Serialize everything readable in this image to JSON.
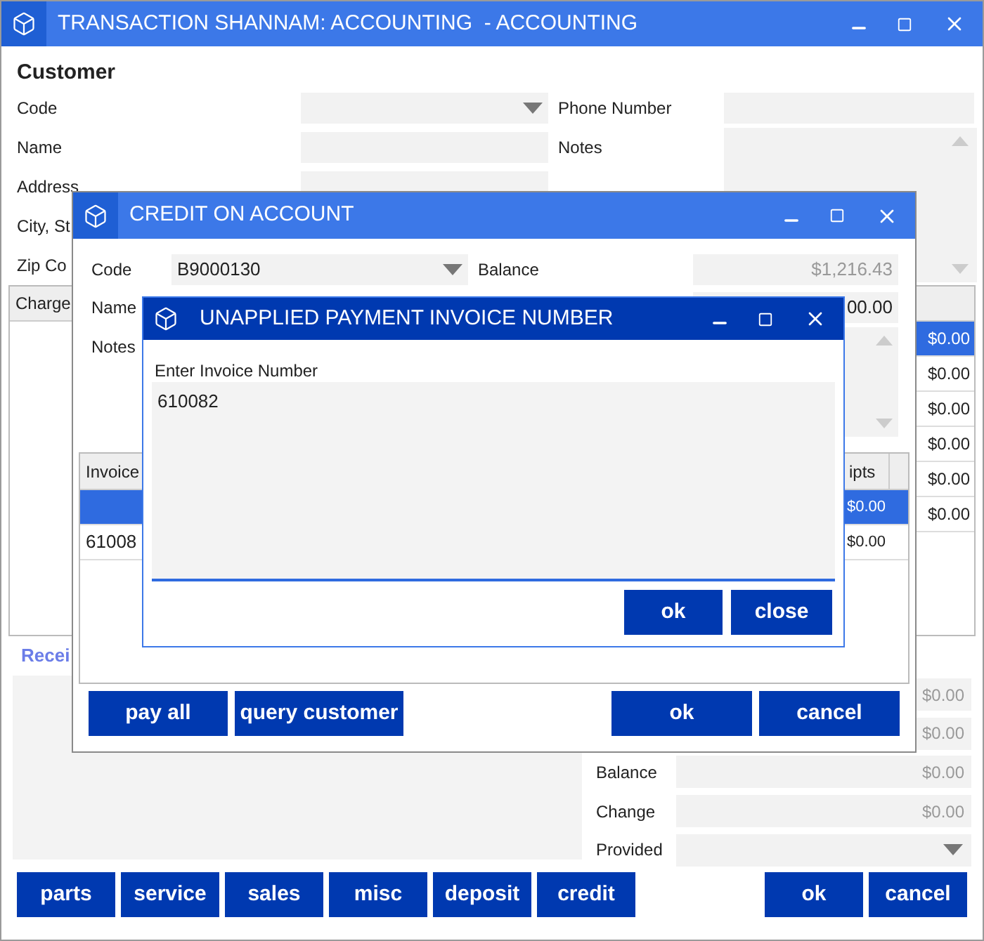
{
  "main": {
    "title": "TRANSACTION SHANNAM: ACCOUNTING  - ACCOUNTING",
    "section": "Customer",
    "left_fields": [
      {
        "label": "Code",
        "kind": "dropdown"
      },
      {
        "label": "Name",
        "kind": "text"
      },
      {
        "label": "Address",
        "kind": "text"
      },
      {
        "label": "City, St",
        "kind": "none"
      },
      {
        "label": "Zip Co",
        "kind": "none"
      }
    ],
    "right_fields": [
      {
        "label": "Phone Number",
        "kind": "text"
      },
      {
        "label": "Notes",
        "kind": "notes"
      }
    ],
    "table": {
      "columns": [
        "Charge"
      ],
      "rows": [
        {
          "value": "$0.00",
          "selected": true
        },
        {
          "value": "$0.00",
          "selected": false
        },
        {
          "value": "$0.00",
          "selected": false
        },
        {
          "value": "$0.00",
          "selected": false
        },
        {
          "value": "$0.00",
          "selected": false
        },
        {
          "value": "$0.00",
          "selected": false
        }
      ]
    },
    "receipts_label": "Recei",
    "totals": [
      {
        "kind": "value",
        "value": "$0.00"
      },
      {
        "kind": "value",
        "value": "$0.00"
      },
      {
        "kind": "value",
        "label": "Balance",
        "value": "$0.00"
      },
      {
        "kind": "value",
        "label": "Change",
        "value": "$0.00"
      },
      {
        "kind": "dropdown",
        "label": "Provided"
      }
    ],
    "buttons_left": [
      "parts",
      "service",
      "sales",
      "misc",
      "deposit",
      "credit"
    ],
    "buttons_right": [
      "ok",
      "cancel"
    ]
  },
  "credit_dialog": {
    "title": "CREDIT ON ACCOUNT",
    "code": {
      "label": "Code",
      "value": "B9000130"
    },
    "balance": {
      "label": "Balance",
      "value": "$1,216.43"
    },
    "name_label": "Name",
    "second_value": "00.00",
    "notes_label": "Notes",
    "table": {
      "columns": [
        "Invoice",
        "ipts"
      ],
      "rows": [
        {
          "receipts": "$0.00",
          "selected": true
        },
        {
          "invoice": "61008",
          "receipts": "$0.00",
          "selected": false
        }
      ]
    },
    "buttons_left": [
      "pay all",
      "query customer"
    ],
    "buttons_right": [
      "ok",
      "cancel"
    ]
  },
  "invoice_dialog": {
    "title": "UNAPPLIED PAYMENT INVOICE NUMBER",
    "label": "Enter Invoice Number",
    "value": "610082",
    "buttons": [
      "ok",
      "close"
    ]
  }
}
